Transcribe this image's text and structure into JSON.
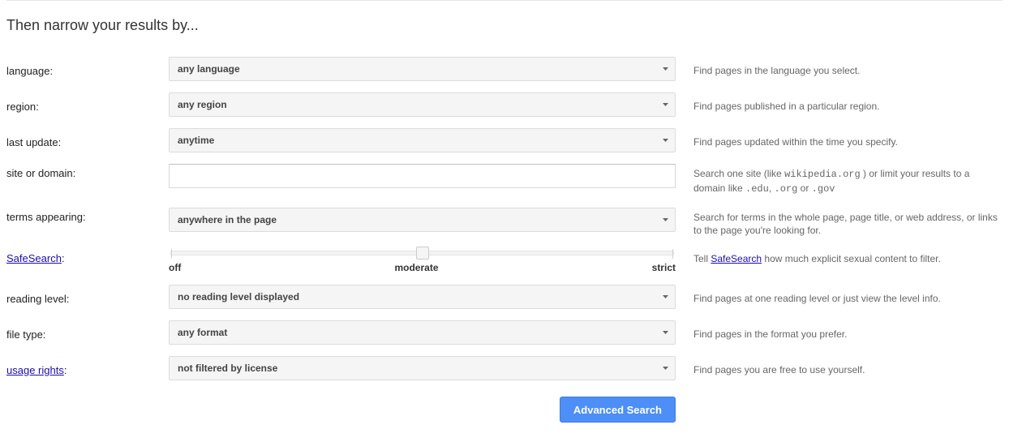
{
  "section_title": "Then narrow your results by...",
  "labels": {
    "language": "language:",
    "region": "region:",
    "last_update": "last update:",
    "site_or_domain": "site or domain:",
    "terms_appearing": "terms appearing:",
    "safesearch": "SafeSearch",
    "safesearch_colon": ":",
    "reading_level": "reading level:",
    "file_type": "file type:",
    "usage_rights": "usage rights",
    "usage_rights_colon": ":"
  },
  "values": {
    "language": "any language",
    "region": "any region",
    "last_update": "anytime",
    "site_or_domain": "",
    "terms_appearing": "anywhere in the page",
    "reading_level": "no reading level displayed",
    "file_type": "any format",
    "usage_rights": "not filtered by license"
  },
  "slider": {
    "off": "off",
    "moderate": "moderate",
    "strict": "strict"
  },
  "hints": {
    "language": "Find pages in the language you select.",
    "region": "Find pages published in a particular region.",
    "last_update": "Find pages updated within the time you specify.",
    "site_a": "Search one site (like ",
    "site_code1": "wikipedia.org",
    "site_b": " ) or limit your results to a domain like ",
    "site_code2": ".edu",
    "site_comma": ", ",
    "site_code3": ".org",
    "site_or": " or ",
    "site_code4": ".gov",
    "terms_appearing": "Search for terms in the whole page, page title, or web address, or links to the page you're looking for.",
    "safesearch_a": "Tell ",
    "safesearch_link": "SafeSearch",
    "safesearch_b": " how much explicit sexual content to filter.",
    "reading_level": "Find pages at one reading level or just view the level info.",
    "file_type": "Find pages in the format you prefer.",
    "usage_rights": "Find pages you are free to use yourself."
  },
  "submit": "Advanced Search"
}
